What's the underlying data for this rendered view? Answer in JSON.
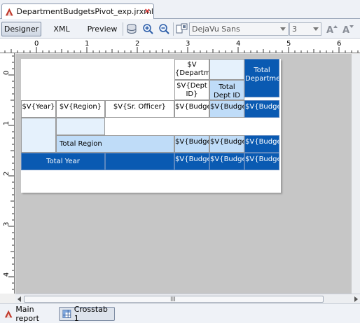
{
  "editor_tab": {
    "title": "DepartmentBudgetsPivot_exp.jrxml",
    "close": "×"
  },
  "toolbar": {
    "designer": "Designer",
    "xml": "XML",
    "preview": "Preview",
    "font_value": "DejaVu Sans",
    "size_value": "3"
  },
  "ruler": {
    "h_labels": [
      "0",
      "1",
      "2",
      "3",
      "4",
      "5",
      "6"
    ],
    "v_labels": [
      "0",
      "1",
      "2",
      "3",
      "4"
    ]
  },
  "crosstab": {
    "col_header_1": "$V {Departme",
    "col_header_2": "$V{Dept ID}",
    "total_dept_id": "Total Dept ID",
    "total_department": "Total Department",
    "year_header": "$V{Year}",
    "region_header": "$V{Region}",
    "officer_header": "$V{Sr. Officer}",
    "budget": "$V{Budget}",
    "total_region": "Total Region",
    "total_year": "Total Year"
  },
  "scrollbar": {
    "grip": "III"
  },
  "bottom_tabs": {
    "main": "Main report",
    "crosstab": "Crosstab 1"
  },
  "colors": {
    "dark_cell": "#0a5ab2",
    "light_cell": "#bfdcf8",
    "pale_cell": "#e5f1fc"
  }
}
